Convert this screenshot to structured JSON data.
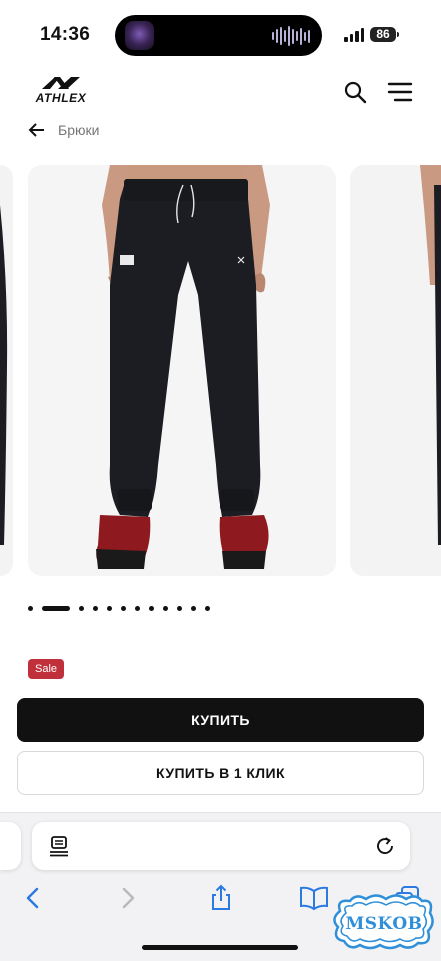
{
  "status_bar": {
    "time": "14:36",
    "battery": "86"
  },
  "header": {
    "logo_text": "ATHLEX",
    "search_icon": "search-icon",
    "menu_icon": "hamburger-menu-icon"
  },
  "breadcrumb": {
    "back_icon": "arrow-left-icon",
    "label": "Брюки"
  },
  "gallery": {
    "slides_visible": 3,
    "total_dots": 12,
    "active_index": 1
  },
  "product": {
    "sale_badge": "Sale",
    "buy_label": "КУПИТЬ",
    "buy_one_click_label": "КУПИТЬ В 1 КЛИК"
  },
  "browser": {
    "reader_icon": "reader-mode-icon",
    "reload_icon": "reload-icon",
    "toolbar": [
      "back-icon",
      "forward-icon",
      "share-icon",
      "bookmarks-icon",
      "tabs-icon"
    ]
  },
  "watermark": "MSKOB",
  "colors": {
    "accent_dark": "#111111",
    "sale": "#c0303b",
    "sheet_bg": "#f2f2f4",
    "stamp_blue": "#2f8fd8"
  }
}
